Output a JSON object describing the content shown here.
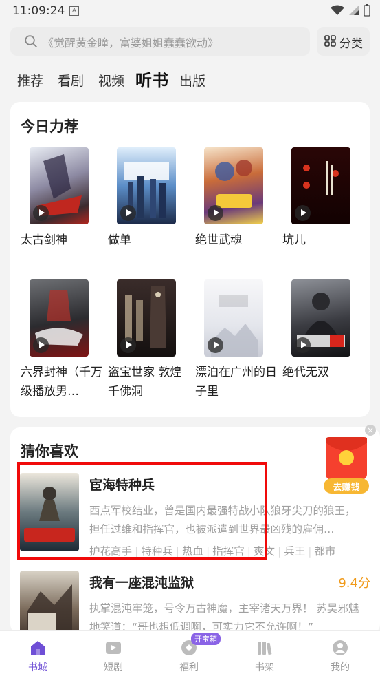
{
  "status": {
    "time": "11:09:24",
    "notif_letter": "A"
  },
  "search": {
    "placeholder": "《觉醒黄金瞳，富婆姐姐蠢蠢欲动》"
  },
  "category_button": {
    "label": "分类"
  },
  "tabs": [
    {
      "label": "推荐"
    },
    {
      "label": "看剧"
    },
    {
      "label": "视频"
    },
    {
      "label": "听书",
      "active": true
    },
    {
      "label": "出版"
    }
  ],
  "featured": {
    "title": "今日力荐",
    "books": [
      {
        "title": "太古剑神"
      },
      {
        "title": "做单"
      },
      {
        "title": "绝世武魂"
      },
      {
        "title": "坑儿"
      },
      {
        "title": "六界封神（千万级播放男…"
      },
      {
        "title": "盗宝世家 敦煌千佛洞"
      },
      {
        "title": "漂泊在广州的日子里"
      },
      {
        "title": "绝代无双"
      }
    ]
  },
  "recommend": {
    "title": "猜你喜欢",
    "items": [
      {
        "title": "宦海特种兵",
        "score": "",
        "desc": "西点军校结业，曾是国内最强特战小队狼牙尖刀的狼王，担任过维和指挥官，也被派遣到世界最凶残的雇佣…",
        "tags": [
          "护花高手",
          "特种兵",
          "热血",
          "指挥官",
          "爽文",
          "兵王",
          "都市"
        ]
      },
      {
        "title": "我有一座混沌监狱",
        "score": "9.4分",
        "desc": "执掌混沌牢笼，号令万古神魔，主宰诸天万界！ 苏昊邪魅地笑道：“哥也想低调啊，可实力它不允许啊！”",
        "tags": []
      }
    ]
  },
  "float_ad": {
    "label": "去赚钱"
  },
  "bottom_nav": [
    {
      "label": "书城",
      "active": true,
      "icon": "house-icon"
    },
    {
      "label": "短剧",
      "icon": "play-icon"
    },
    {
      "label": "福利",
      "icon": "gift-icon",
      "badge": "开宝箱"
    },
    {
      "label": "书架",
      "icon": "bookshelf-icon"
    },
    {
      "label": "我的",
      "icon": "profile-icon"
    }
  ],
  "colors": {
    "accent": "#6f4fd6",
    "score": "#f09a1a",
    "highlight": "#f00a0a"
  }
}
